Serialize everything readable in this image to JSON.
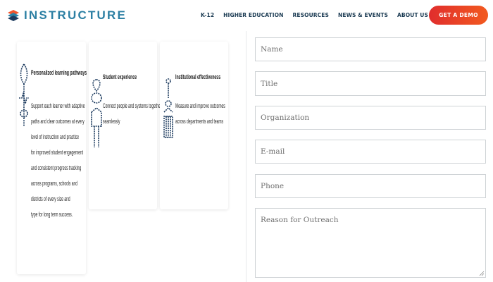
{
  "brand": {
    "name": "INSTRUCTURE",
    "logo_icon": "instructure-logo-icon"
  },
  "nav": {
    "items": [
      "K-12",
      "HIGHER EDUCATION",
      "RESOURCES",
      "NEWS & EVENTS",
      "ABOUT US"
    ],
    "cta": "GET A DEMO"
  },
  "cards": [
    {
      "icon": "leaf-pulse-icon",
      "title": "Personalized learning pathways",
      "lines": [
        "Support each learner with adaptive",
        "paths and clear outcomes at every",
        "level of instruction and practice",
        "for improved student engagement",
        "and consistent progress tracking",
        "across programs, schools and",
        "districts of every size and",
        "type for long term success."
      ]
    },
    {
      "icon": "graduate-heart-icon",
      "title": "Student experience",
      "lines": [
        "Connect people and systems together",
        "seamlessly"
      ]
    },
    {
      "icon": "building-people-icon",
      "title": "Institutional effectiveness",
      "lines": [
        "Measure and improve outcomes",
        "across departments and teams"
      ]
    }
  ],
  "form": {
    "name_placeholder": "Name",
    "title_placeholder": "Title",
    "organization_placeholder": "Organization",
    "email_placeholder": "E-mail",
    "phone_placeholder": "Phone",
    "reason_placeholder": "Reason for Outreach"
  },
  "colors": {
    "brand_blue": "#2c7fa3",
    "nav_text": "#1a3a52",
    "cta_start": "#e02d2d",
    "cta_end": "#f25a1f",
    "icon_navy": "#1c3a5e"
  }
}
